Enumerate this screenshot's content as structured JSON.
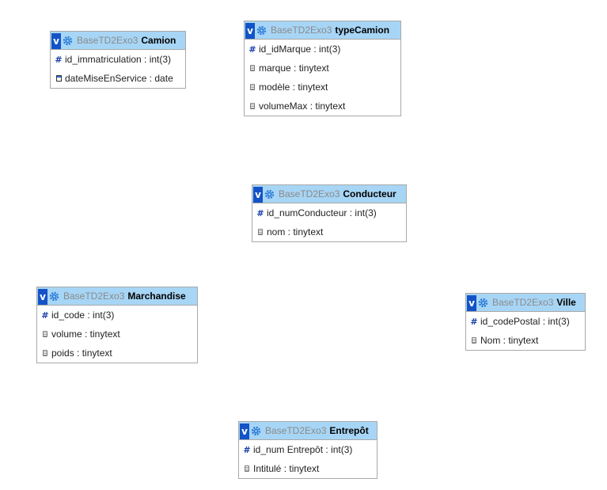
{
  "tables": [
    {
      "db": "BaseTD2Exo3",
      "name": "Camion",
      "columns": [
        {
          "text": "id_immatriculation : int(3)",
          "icon": "primary-key-icon"
        },
        {
          "text": "dateMiseEnService : date",
          "icon": "date-icon"
        }
      ]
    },
    {
      "db": "BaseTD2Exo3",
      "name": "typeCamion",
      "columns": [
        {
          "text": "id_idMarque : int(3)",
          "icon": "primary-key-icon"
        },
        {
          "text": "marque : tinytext",
          "icon": "text-icon"
        },
        {
          "text": "modèle : tinytext",
          "icon": "text-icon"
        },
        {
          "text": "volumeMax : tinytext",
          "icon": "text-icon"
        }
      ]
    },
    {
      "db": "BaseTD2Exo3",
      "name": "Conducteur",
      "columns": [
        {
          "text": "id_numConducteur : int(3)",
          "icon": "primary-key-icon"
        },
        {
          "text": "nom : tinytext",
          "icon": "text-icon"
        }
      ]
    },
    {
      "db": "BaseTD2Exo3",
      "name": "Marchandise",
      "columns": [
        {
          "text": "id_code : int(3)",
          "icon": "primary-key-icon"
        },
        {
          "text": "volume : tinytext",
          "icon": "text-icon"
        },
        {
          "text": "poids : tinytext",
          "icon": "text-icon"
        }
      ]
    },
    {
      "db": "BaseTD2Exo3",
      "name": "Ville",
      "columns": [
        {
          "text": "id_codePostal : int(3)",
          "icon": "primary-key-icon"
        },
        {
          "text": "Nom : tinytext",
          "icon": "text-icon"
        }
      ]
    },
    {
      "db": "BaseTD2Exo3",
      "name": "Entrepôt",
      "columns": [
        {
          "text": "id_num Entrepôt : int(3)",
          "icon": "primary-key-icon"
        },
        {
          "text": "Intitulé : tinytext",
          "icon": "text-icon"
        }
      ]
    }
  ],
  "toggle_label": "v",
  "pk_glyph": "#",
  "colors": {
    "header": "#a7d5f5",
    "toggle": "#1353c7",
    "db_text": "#8a8a8a",
    "border": "#a9a9a9"
  }
}
